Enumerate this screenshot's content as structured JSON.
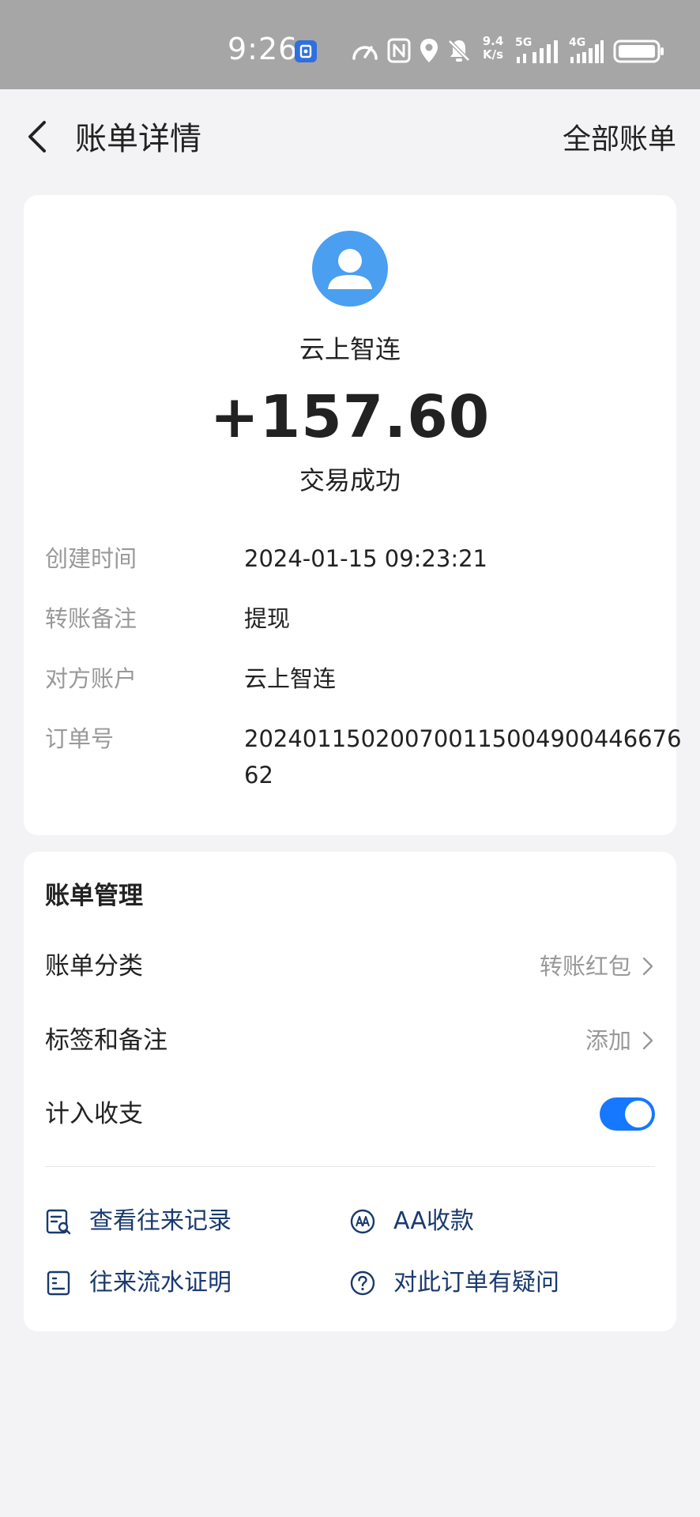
{
  "status_bar": {
    "time": "9:26",
    "net_speed_value": "9.4",
    "net_speed_unit": "K/s",
    "sig1_label": "5G",
    "sig2_label": "4G"
  },
  "header": {
    "title": "账单详情",
    "all_bills_label": "全部账单"
  },
  "transaction": {
    "counterparty": "云上智连",
    "amount": "+157.60",
    "status": "交易成功"
  },
  "details": {
    "created_time_label": "创建时间",
    "created_time_value": "2024-01-15 09:23:21",
    "remark_label": "转账备注",
    "remark_value": "提现",
    "account_label": "对方账户",
    "account_value": "云上智连",
    "order_label": "订单号",
    "order_value": "20240115020070011500490044667662"
  },
  "manage": {
    "title": "账单管理",
    "category_label": "账单分类",
    "category_value": "转账红包",
    "tags_label": "标签和备注",
    "tags_value": "添加",
    "count_label": "计入收支",
    "count_enabled": true
  },
  "actions": {
    "history_label": "查看往来记录",
    "aa_label": "AA收款",
    "proof_label": "往来流水证明",
    "question_label": "对此订单有疑问"
  },
  "colors": {
    "accent": "#1677ff",
    "avatar": "#4a9ff0",
    "action_text": "#1a3a6e"
  }
}
